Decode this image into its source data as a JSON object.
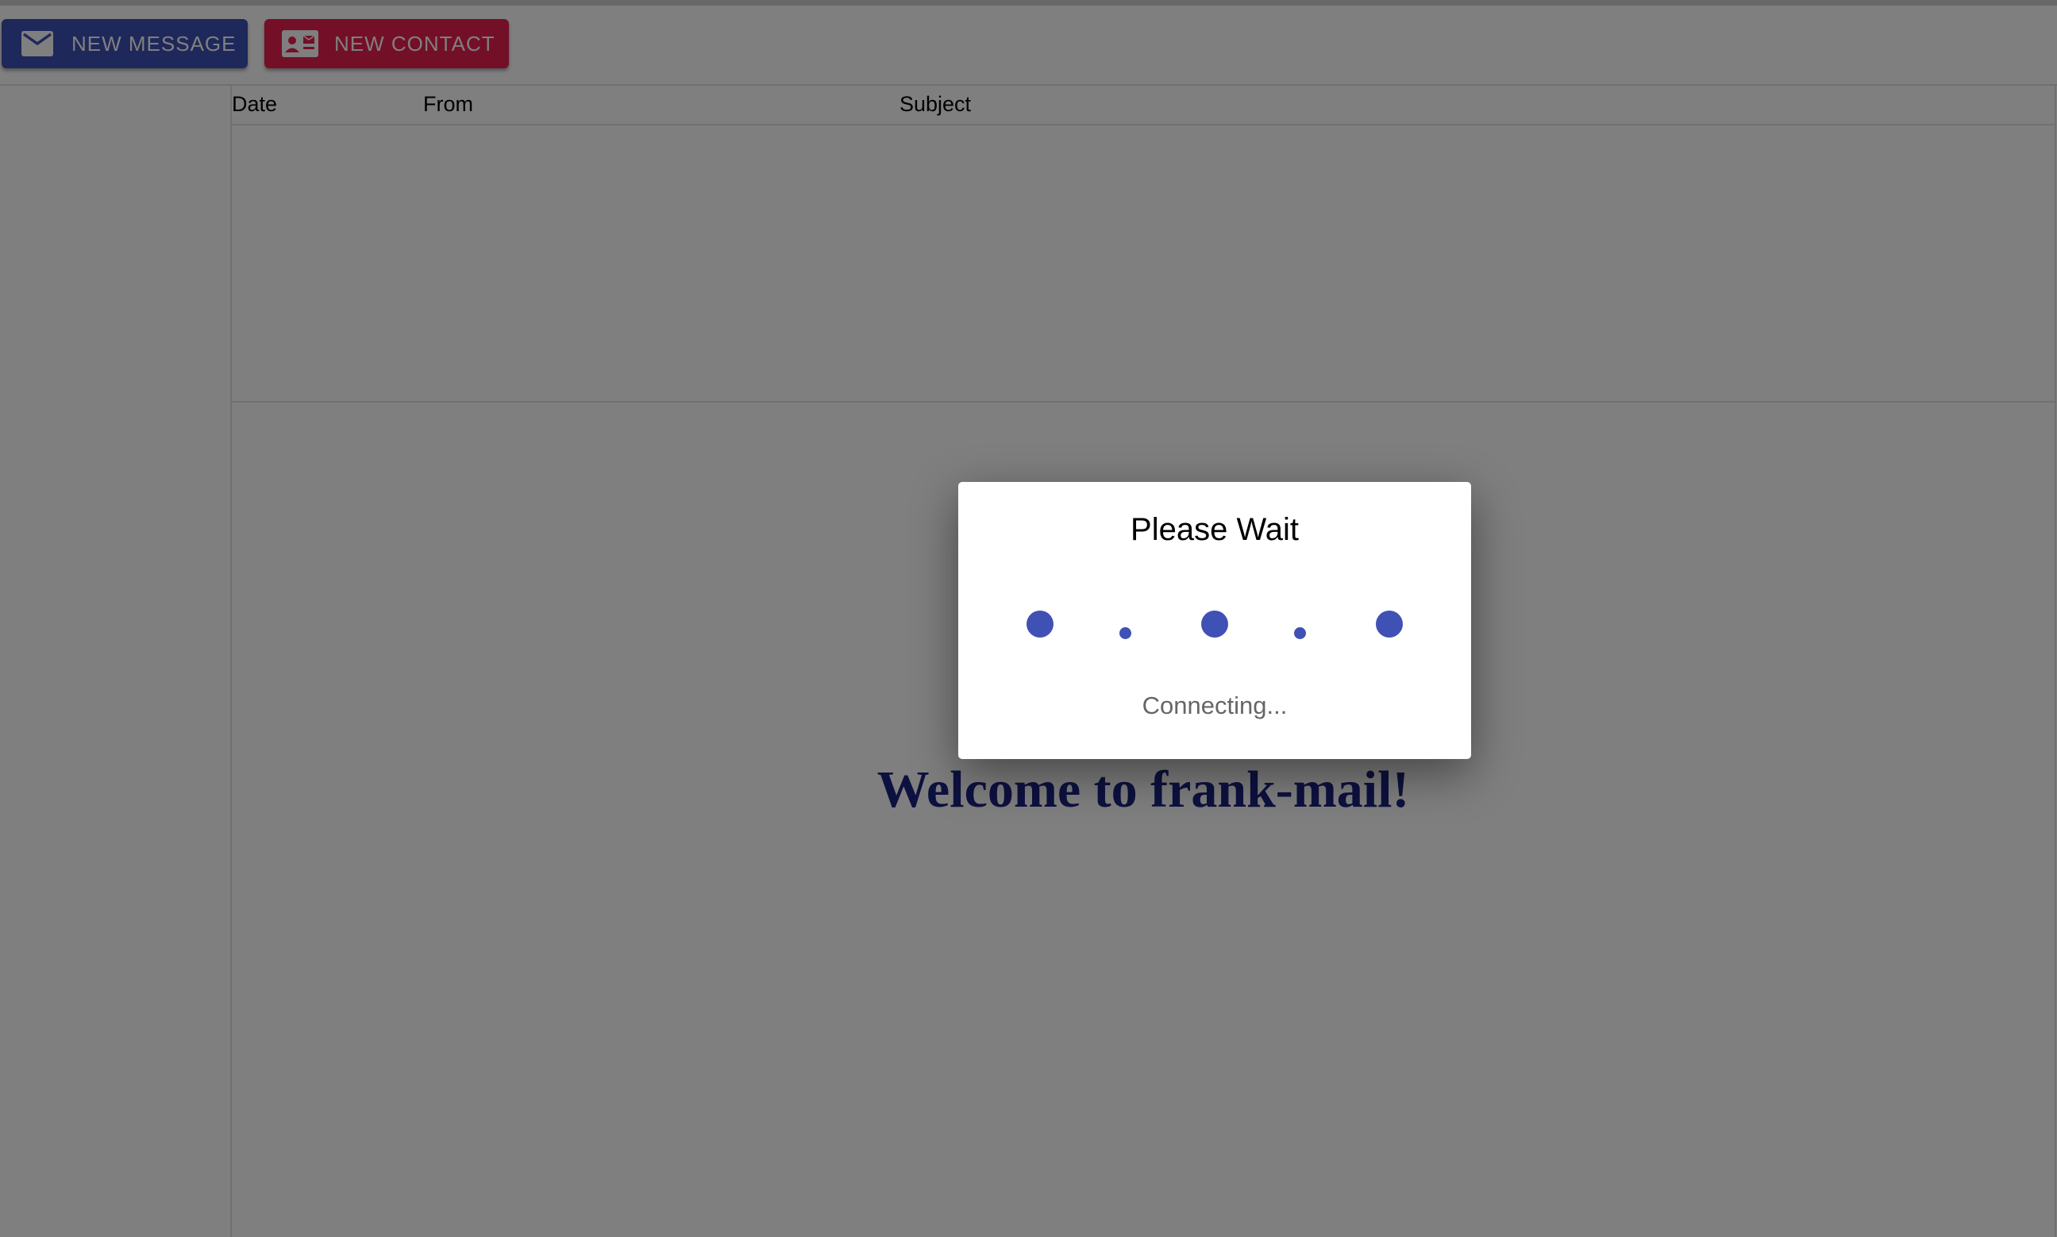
{
  "toolbar": {
    "new_message_label": "NEW MESSAGE",
    "new_contact_label": "NEW CONTACT",
    "new_message_icon": "envelope-icon",
    "new_contact_icon": "contact-card-icon"
  },
  "message_list": {
    "columns": [
      "Date",
      "From",
      "Subject"
    ],
    "rows": []
  },
  "message_view": {
    "welcome_text": "Welcome to frank-mail!"
  },
  "dialog": {
    "title": "Please Wait",
    "status": "Connecting..."
  },
  "colors": {
    "primary": "#3f51b5",
    "secondary": "#e91e50",
    "welcome_text": "#1a237e",
    "overlay": "rgba(0,0,0,0.5)"
  }
}
